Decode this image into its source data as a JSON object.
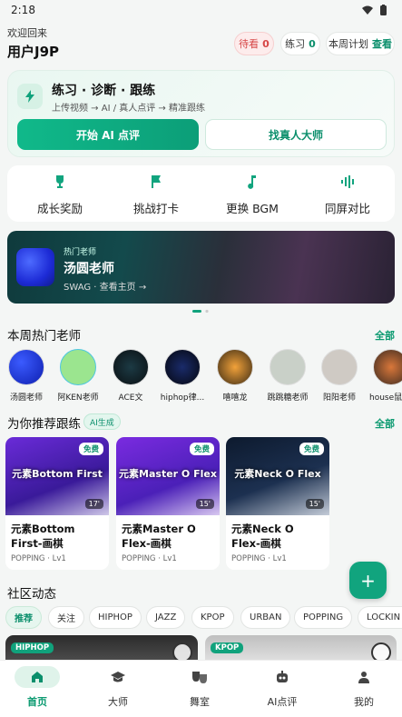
{
  "status": {
    "time": "2:18"
  },
  "header": {
    "welcome": "欢迎回来",
    "username": "用户J9P"
  },
  "stats": [
    {
      "label": "待看",
      "value": "0"
    },
    {
      "label": "练习",
      "value": "0"
    },
    {
      "label": "本周计划",
      "value": "查看"
    }
  ],
  "hero": {
    "title": "练习 · 诊断 · 跟练",
    "subtitle": "上传视频 → AI / 真人点评 → 精准跟练",
    "primary": "开始 AI 点评",
    "secondary": "找真人大师"
  },
  "quick": [
    {
      "icon": "trophy-icon",
      "label": "成长奖励"
    },
    {
      "icon": "flag-icon",
      "label": "挑战打卡"
    },
    {
      "icon": "music-note-icon",
      "label": "更换 BGM"
    },
    {
      "icon": "waveform-icon",
      "label": "同屏对比"
    }
  ],
  "banner": {
    "tag": "热门老师",
    "name": "汤圆老师",
    "sub": "SWAG · 查看主页 →"
  },
  "teachers_section": {
    "title": "本周热门老师",
    "all": "全部"
  },
  "teachers": [
    "汤圆老师",
    "阿KEN老师",
    "ACE文",
    "hiphop律...",
    "嘻嘻龙",
    "跳跳糖老师",
    "阳阳老师",
    "house鼠"
  ],
  "recommend": {
    "title": "为你推荐跟练",
    "tag": "AI生成",
    "all": "全部"
  },
  "cards": [
    {
      "caption": "元素Bottom First",
      "title": "元素Bottom First-画棋",
      "level": "POPPING · Lv1",
      "duration": "17'",
      "badge": "免费"
    },
    {
      "caption": "元素Master O Flex",
      "title": "元素Master O Flex-画棋",
      "level": "POPPING · Lv1",
      "duration": "15'",
      "badge": "免费"
    },
    {
      "caption": "元素Neck O Flex",
      "title": "元素Neck O Flex-画棋",
      "level": "POPPING · Lv1",
      "duration": "15'",
      "badge": "免费"
    }
  ],
  "community": {
    "title": "社区动态"
  },
  "chips": [
    "推荐",
    "关注",
    "HIPHOP",
    "JAZZ",
    "KPOP",
    "URBAN",
    "POPPING",
    "LOCKIN"
  ],
  "feed": [
    "HIPHOP",
    "KPOP"
  ],
  "nav": [
    {
      "icon": "home-icon",
      "label": "首页"
    },
    {
      "icon": "graduation-cap-icon",
      "label": "大师"
    },
    {
      "icon": "theater-masks-icon",
      "label": "舞室"
    },
    {
      "icon": "robot-icon",
      "label": "AI点评"
    },
    {
      "icon": "person-icon",
      "label": "我的"
    }
  ],
  "accent": "#10a27c"
}
